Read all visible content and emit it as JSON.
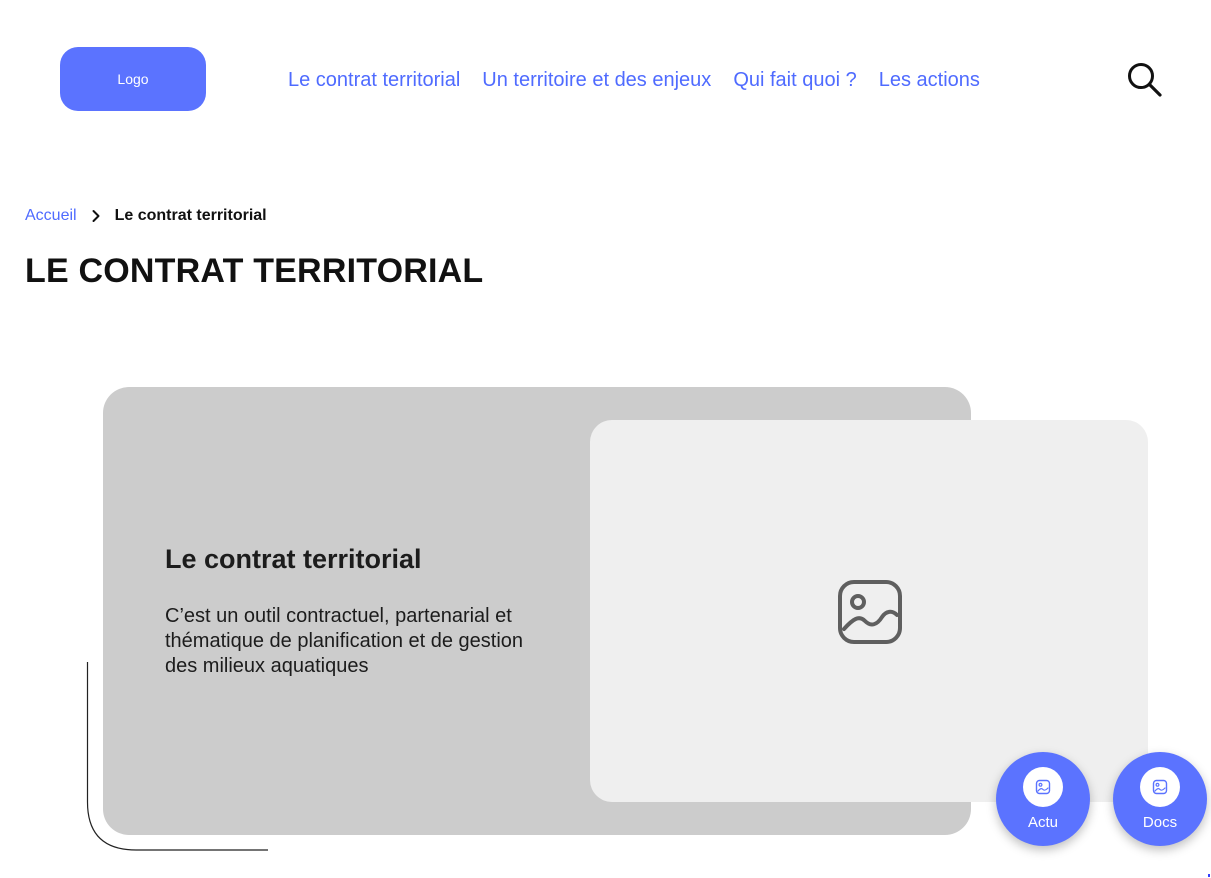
{
  "header": {
    "logo_label": "Logo",
    "nav": [
      {
        "label": "Le contrat territorial"
      },
      {
        "label": "Un territoire et des enjeux"
      },
      {
        "label": "Qui fait quoi ?"
      },
      {
        "label": "Les actions"
      }
    ],
    "search_icon": "search-icon"
  },
  "breadcrumb": {
    "home": "Accueil",
    "separator_icon": "chevron-right-icon",
    "current": "Le contrat territorial"
  },
  "page": {
    "title": "LE CONTRAT TERRITORIAL"
  },
  "card": {
    "title": "Le contrat territorial",
    "description": "C’est un outil contractuel, partenarial et thématique de planification et de gestion des milieux aquatiques",
    "image_icon": "image-placeholder-icon"
  },
  "fabs": [
    {
      "label": "Actu",
      "icon": "image-icon"
    },
    {
      "label": "Docs",
      "icon": "image-icon"
    }
  ],
  "colors": {
    "accent": "#5B73FF",
    "link": "#4F6BFF",
    "card_bg": "#CCCCCC",
    "panel_bg": "#EFEFEF",
    "text": "#111111"
  }
}
